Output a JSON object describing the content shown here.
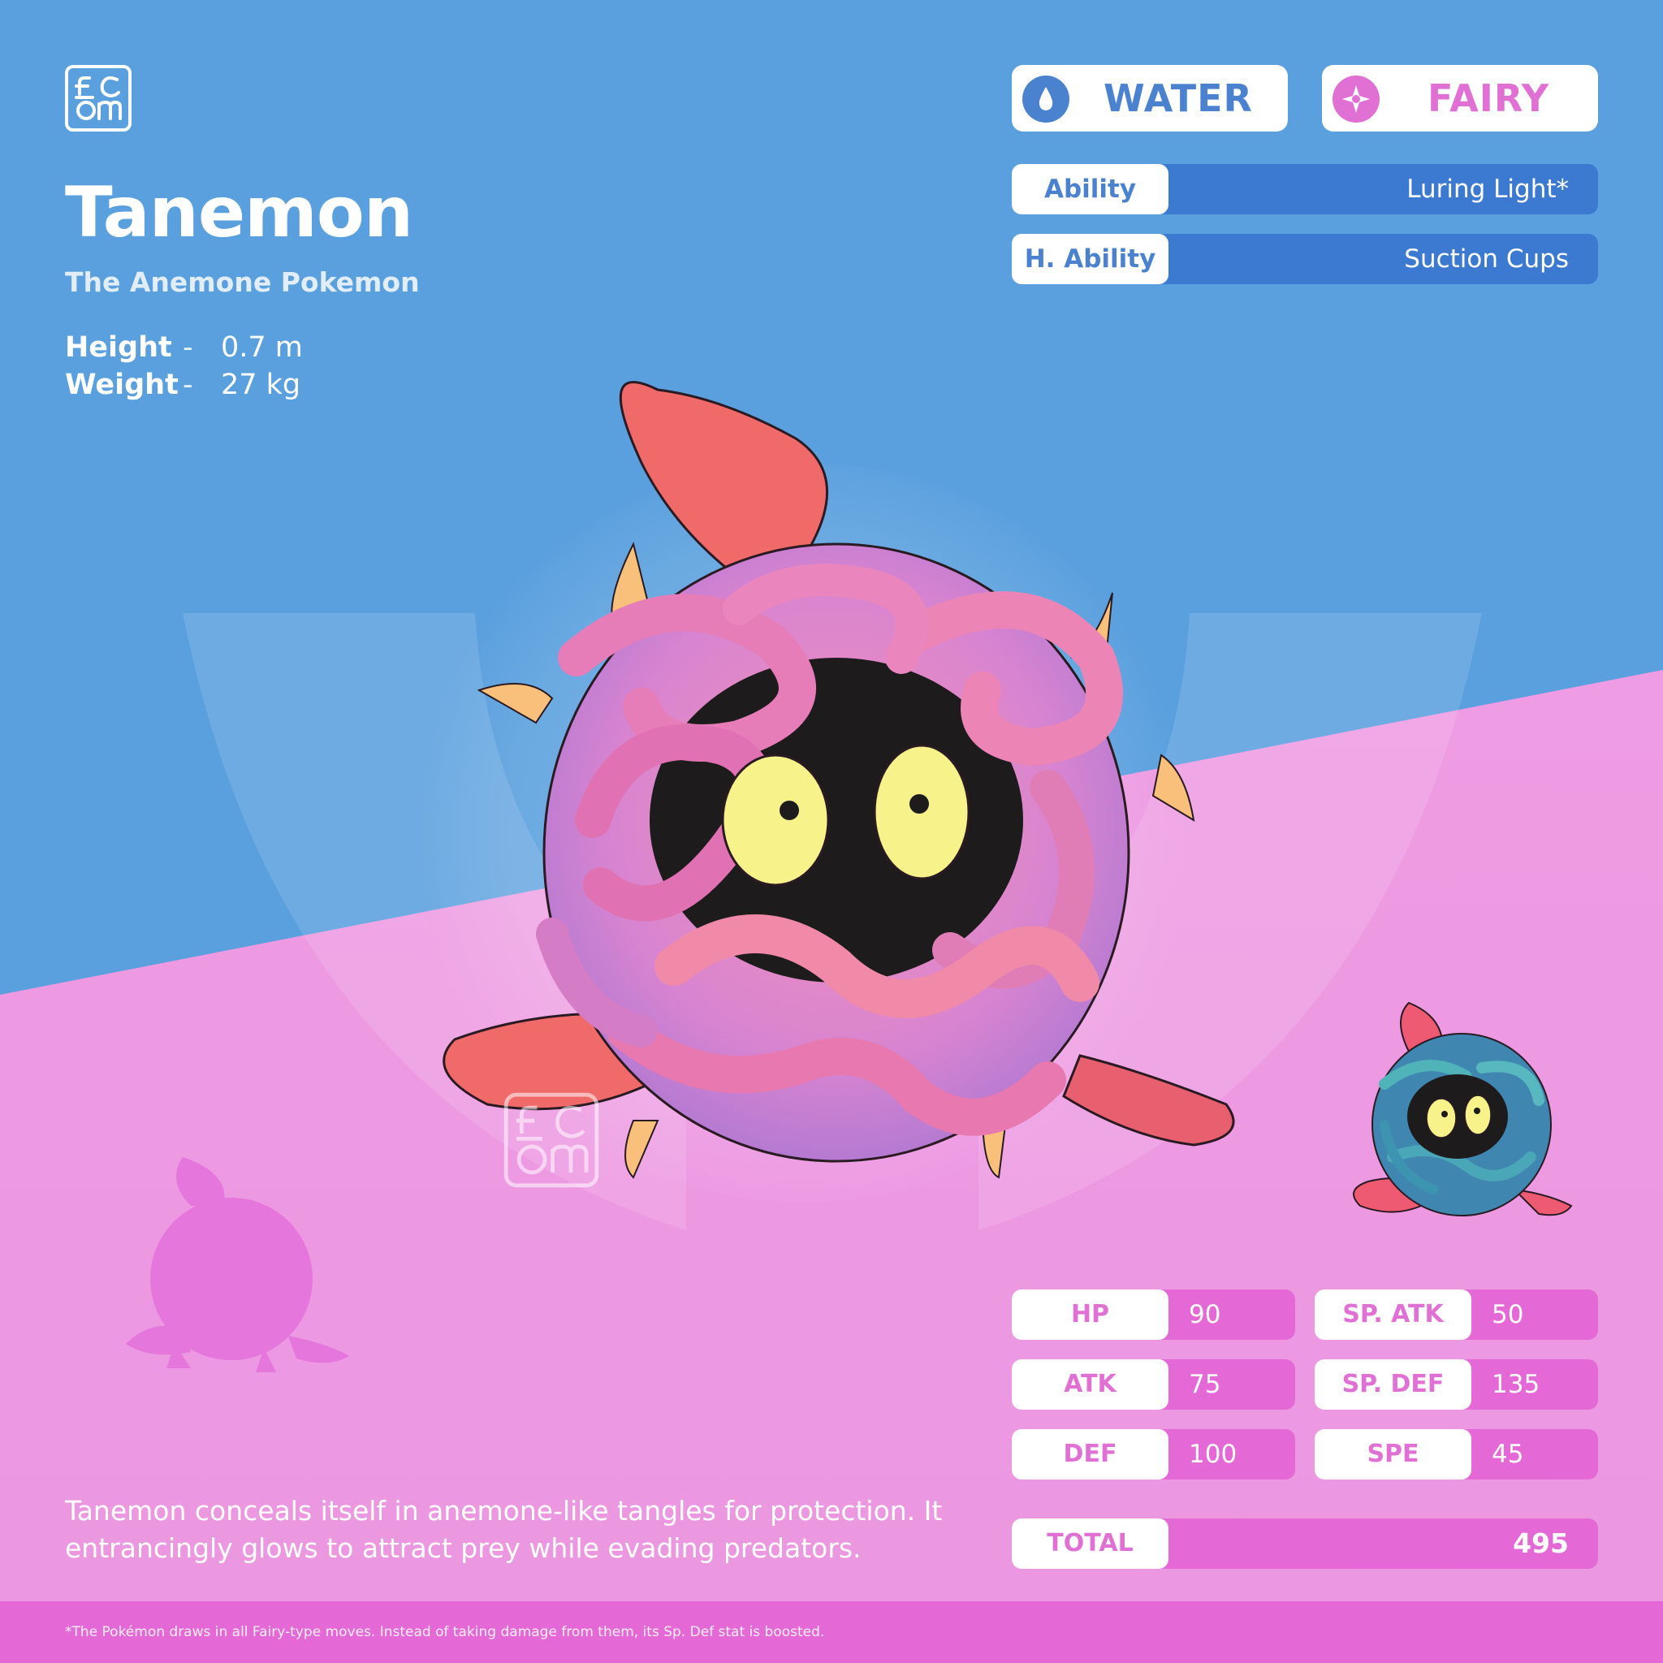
{
  "brand": {
    "logo_text": "f_c om"
  },
  "pokemon": {
    "name": "Tanemon",
    "category": "The Anemone Pokemon",
    "height_label": "Height",
    "height_value": "0.7 m",
    "weight_label": "Weight",
    "weight_value": "27 kg",
    "separator": "-"
  },
  "types": [
    {
      "label": "WATER",
      "color": "#4a82cf",
      "icon": "water-drop-icon"
    },
    {
      "label": "FAIRY",
      "color": "#e170d4",
      "icon": "fairy-star-icon"
    }
  ],
  "abilities": [
    {
      "label": "Ability",
      "value": "Luring Light*"
    },
    {
      "label": "H. Ability",
      "value": "Suction Cups"
    }
  ],
  "stats": [
    {
      "label": "HP",
      "value": "90"
    },
    {
      "label": "ATK",
      "value": "75"
    },
    {
      "label": "DEF",
      "value": "100"
    },
    {
      "label": "SP. ATK",
      "value": "50"
    },
    {
      "label": "SP. DEF",
      "value": "135"
    },
    {
      "label": "SPE",
      "value": "45"
    }
  ],
  "total": {
    "label": "TOTAL",
    "value": "495"
  },
  "description": "Tanemon conceals itself in anemone-like tangles for protection. It entrancingly glows to attract prey while evading predators.",
  "footnote": "*The Pokémon draws in all Fairy-type moves. Instead of taking damage from them, its Sp. Def stat is boosted.",
  "colors": {
    "sky_blue": "#5aa0de",
    "pink_bg": "#ec97e1",
    "ability_bar": "#3b7ad0",
    "stat_bar": "#e469d6",
    "body_pink": "#e785c4",
    "fin_red": "#f06a6a",
    "eye_yellow": "#f7f28a",
    "shiny_teal": "#4aa7b8"
  }
}
